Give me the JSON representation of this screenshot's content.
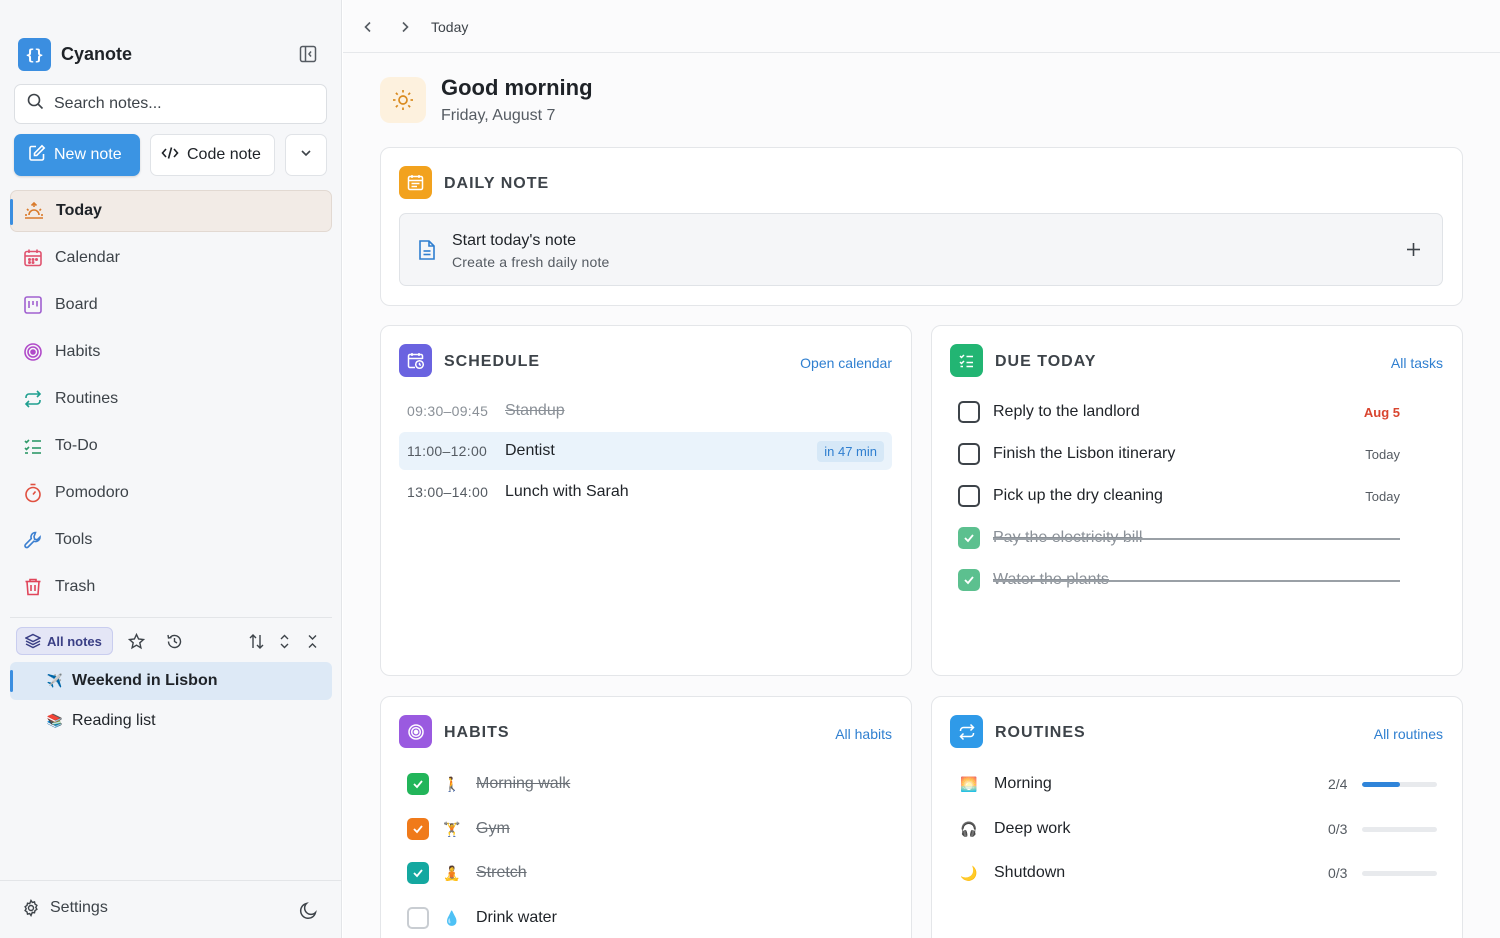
{
  "app": {
    "name": "Cyanote",
    "logo_text": "{}"
  },
  "sidebar": {
    "search_placeholder": "Search notes...",
    "new_note_label": "New note",
    "code_note_label": "Code note",
    "nav": [
      {
        "label": "Today",
        "icon": "sunrise-icon",
        "active": true,
        "color": "#d97a2b"
      },
      {
        "label": "Calendar",
        "icon": "calendar-icon",
        "active": false,
        "color": "#e0536f"
      },
      {
        "label": "Board",
        "icon": "kanban-icon",
        "active": false,
        "color": "#a060d0"
      },
      {
        "label": "Habits",
        "icon": "target-icon",
        "active": false,
        "color": "#b049c9"
      },
      {
        "label": "Routines",
        "icon": "repeat-icon",
        "active": false,
        "color": "#1e9f8f"
      },
      {
        "label": "To-Do",
        "icon": "checklist-icon",
        "active": false,
        "color": "#2f9a6a"
      },
      {
        "label": "Pomodoro",
        "icon": "timer-icon",
        "active": false,
        "color": "#e05040"
      },
      {
        "label": "Tools",
        "icon": "wrench-icon",
        "active": false,
        "color": "#3b7fd0"
      },
      {
        "label": "Trash",
        "icon": "trash-icon",
        "active": false,
        "color": "#e0455a"
      }
    ],
    "notes_filter_label": "All notes",
    "notes": [
      {
        "title": "Weekend in Lisbon",
        "emoji": "✈️",
        "active": true
      },
      {
        "title": "Reading list",
        "emoji": "📚",
        "active": false
      }
    ],
    "settings_label": "Settings"
  },
  "topbar": {
    "breadcrumb": "Today"
  },
  "greeting": {
    "title": "Good morning",
    "date": "Friday, August 7"
  },
  "daily_note": {
    "section_title": "DAILY NOTE",
    "start_title": "Start today's note",
    "start_subtitle": "Create a fresh daily note"
  },
  "schedule": {
    "section_title": "SCHEDULE",
    "link": "Open calendar",
    "events": [
      {
        "time": "09:30–09:45",
        "title": "Standup",
        "done": true,
        "badge": ""
      },
      {
        "time": "11:00–12:00",
        "title": "Dentist",
        "done": false,
        "current": true,
        "badge": "in 47 min"
      },
      {
        "time": "13:00–14:00",
        "title": "Lunch with Sarah",
        "done": false,
        "badge": ""
      }
    ]
  },
  "due_today": {
    "section_title": "DUE TODAY",
    "link": "All tasks",
    "tasks": [
      {
        "title": "Reply to the landlord",
        "due": "Aug 5",
        "overdue": true,
        "done": false
      },
      {
        "title": "Finish the Lisbon itinerary",
        "due": "Today",
        "overdue": false,
        "done": false
      },
      {
        "title": "Pick up the dry cleaning",
        "due": "Today",
        "overdue": false,
        "done": false
      },
      {
        "title": "Pay the electricity bill",
        "due": "",
        "overdue": false,
        "done": true
      },
      {
        "title": "Water the plants",
        "due": "",
        "overdue": false,
        "done": true
      }
    ]
  },
  "habits": {
    "section_title": "HABITS",
    "link": "All habits",
    "items": [
      {
        "title": "Morning walk",
        "emoji": "🚶",
        "done": true,
        "color": "#22b55a"
      },
      {
        "title": "Gym",
        "emoji": "🏋️",
        "done": true,
        "color": "#f07a1a"
      },
      {
        "title": "Stretch",
        "emoji": "🧘",
        "done": true,
        "color": "#14a8a0"
      },
      {
        "title": "Drink water",
        "emoji": "💧",
        "done": false,
        "color": "#3b8ee0"
      }
    ]
  },
  "routines": {
    "section_title": "ROUTINES",
    "link": "All routines",
    "items": [
      {
        "title": "Morning",
        "emoji": "🌅",
        "count": "2/4",
        "progress": 0.5
      },
      {
        "title": "Deep work",
        "emoji": "🎧",
        "count": "0/3",
        "progress": 0
      },
      {
        "title": "Shutdown",
        "emoji": "🌙",
        "count": "0/3",
        "progress": 0
      }
    ]
  },
  "colors": {
    "accent": "#3b94e3",
    "daily_icon": "#f2a21e",
    "schedule_icon": "#6a63e0",
    "due_icon": "#22b573",
    "habits_icon": "#9a5ae0",
    "routines_icon": "#2f9ae8"
  }
}
